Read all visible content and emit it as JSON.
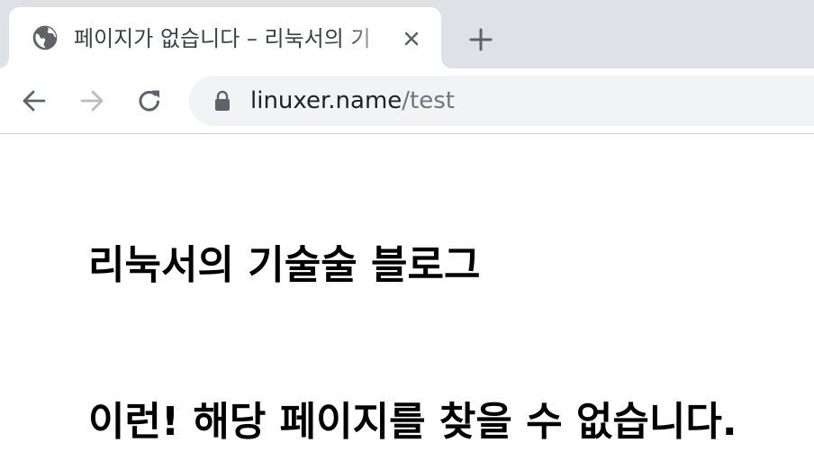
{
  "tab": {
    "title": "페이지가 없습니다 – 리눅서의 기",
    "favicon_icon": "globe-icon",
    "close_icon": "close-icon"
  },
  "toolbar": {
    "back_icon": "arrow-left-icon",
    "forward_icon": "arrow-right-icon",
    "reload_icon": "reload-icon",
    "new_tab_icon": "plus-icon"
  },
  "address_bar": {
    "lock_icon": "lock-icon",
    "host": "linuxer.name",
    "path": "/test"
  },
  "page": {
    "blog_title": "리눅서의 기술술 블로그",
    "error_message": "이런! 해당 페이지를 찾을 수 없습니다."
  },
  "colors": {
    "tab_strip": "#dee1e6",
    "omnibox": "#f1f3f4",
    "icon": "#5f6368",
    "disabled_icon": "#b9bcc0"
  }
}
